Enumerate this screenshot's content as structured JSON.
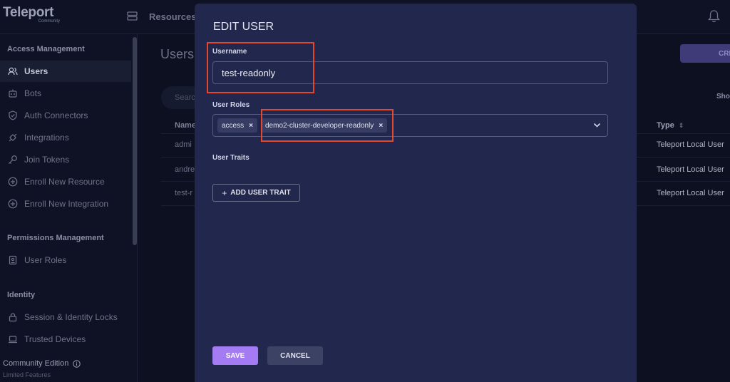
{
  "app": {
    "logo": "Teleport",
    "logo_sub": "Community"
  },
  "topbar": {
    "resources_label": "Resources"
  },
  "sidebar": {
    "sections": [
      {
        "title": "Access Management",
        "items": [
          "Users",
          "Bots",
          "Auth Connectors",
          "Integrations",
          "Join Tokens",
          "Enroll New Resource",
          "Enroll New Integration"
        ]
      },
      {
        "title": "Permissions Management",
        "items": [
          "User Roles"
        ]
      },
      {
        "title": "Identity",
        "items": [
          "Session & Identity Locks",
          "Trusted Devices"
        ]
      }
    ],
    "active_item": "Users",
    "footer_title": "Community Edition",
    "footer_sub": "Limited Features"
  },
  "background": {
    "page_title": "Users",
    "create_button": "CRE",
    "search_placeholder": "Searc",
    "show_label": "Sho",
    "columns": {
      "name": "Name",
      "type": "Type"
    },
    "rows": [
      {
        "name": "admi",
        "type": "Teleport Local User"
      },
      {
        "name": "andre",
        "type": "Teleport Local User"
      },
      {
        "name": "test-r",
        "type": "Teleport Local User"
      }
    ]
  },
  "modal": {
    "title": "EDIT USER",
    "username_label": "Username",
    "username_value": "test-readonly",
    "roles_label": "User Roles",
    "roles": [
      "access",
      "demo2-cluster-developer-readonly"
    ],
    "traits_label": "User Traits",
    "add_trait_label": "ADD USER TRAIT",
    "save_label": "SAVE",
    "cancel_label": "CANCEL"
  },
  "colors": {
    "accent": "#a47bf2",
    "highlight": "#e6462c",
    "modal_bg": "#22284d"
  }
}
